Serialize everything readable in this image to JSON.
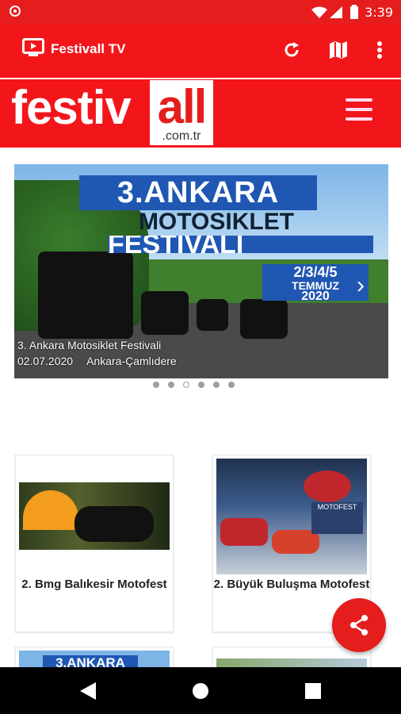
{
  "status_bar": {
    "time": "3:39"
  },
  "toolbar": {
    "title": "Festivall TV"
  },
  "brand": {
    "logo_main": "festiv",
    "logo_highlight": "all",
    "logo_domain": ".com.tr"
  },
  "carousel": {
    "banner_title_line1": "3.ANKARA",
    "banner_title_line2": "MOTOSIKLET",
    "banner_title_line3": "FESTIVALI",
    "banner_dates": "2/3/4/5",
    "banner_month": "TEMMUZ",
    "banner_year": "2020",
    "caption_title": "3. Ankara Motosiklet Festivali",
    "caption_date": "02.07.2020",
    "caption_location": "Ankara-Çamlıdere",
    "page_count": 6,
    "active_index": 2
  },
  "cards": [
    {
      "title": "2. Bmg Balıkesir Motofest"
    },
    {
      "title": "2. Büyük Buluşma Motofest"
    },
    {
      "title": "3.ANKARA"
    },
    {
      "title": ""
    }
  ],
  "colors": {
    "brand_red": "#f2161b",
    "status_red": "#e51d1d"
  },
  "icons": [
    "tv-icon",
    "refresh-icon",
    "map-icon",
    "more-vert-icon",
    "menu-icon",
    "share-icon",
    "back-icon",
    "home-icon",
    "recents-icon"
  ]
}
